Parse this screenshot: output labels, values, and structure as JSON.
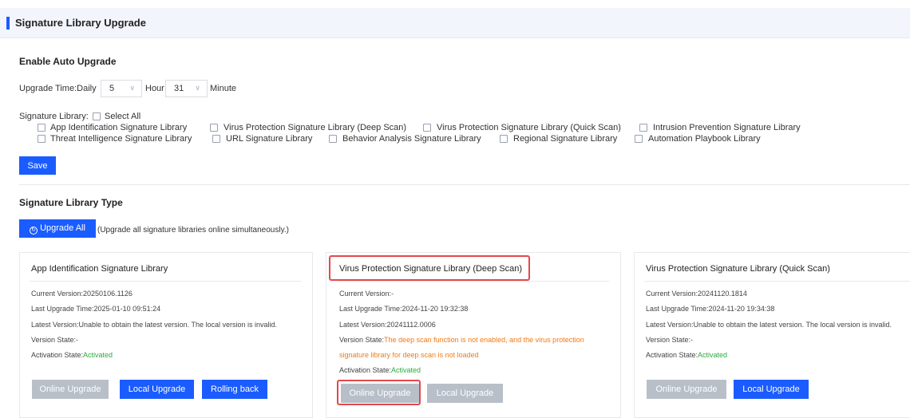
{
  "header": {
    "title": "Signature Library Upgrade"
  },
  "auto_upgrade": {
    "title": "Enable Auto Upgrade",
    "time_label": "Upgrade Time:Daily",
    "hour_value": "5",
    "hour_label": "Hour",
    "minute_value": "31",
    "minute_label": "Minute",
    "library_label": "Signature Library:",
    "select_all": "Select All",
    "libraries": [
      "App Identification Signature Library",
      "Virus Protection Signature Library (Deep Scan)",
      "Virus Protection Signature Library (Quick Scan)",
      "Intrusion Prevention Signature Library",
      "Threat Intelligence Signature Library",
      "URL Signature Library",
      "Behavior Analysis Signature Library",
      "Regional Signature Library",
      "Automation Playbook Library"
    ],
    "save_label": "Save"
  },
  "type_section": {
    "title": "Signature Library Type",
    "upgrade_all_label": "Upgrade All",
    "upgrade_all_icon": "refresh-circle-icon",
    "upgrade_all_hint": "(Upgrade all signature libraries online simultaneously.)"
  },
  "cards": [
    {
      "title": "App Identification Signature Library",
      "current_version": "Current Version:20250106.1126",
      "last_upgrade": "Last Upgrade Time:2025-01-10 09:51:24",
      "latest_version": "Latest Version:Unable to obtain the latest version. The local version is invalid.",
      "version_state_label": "Version State:",
      "version_state_value": "-",
      "activation_label": "Activation State:",
      "activation_value": "Activated",
      "online_upgrade": "Online Upgrade",
      "local_upgrade": "Local Upgrade",
      "rolling_back": "Rolling back"
    },
    {
      "title": "Virus Protection Signature Library (Deep Scan)",
      "current_version": "Current Version:-",
      "last_upgrade": "Last Upgrade Time:2024-11-20 19:32:38",
      "latest_version": "Latest Version:20241112.0006",
      "version_state_label": "Version State:",
      "version_state_value": "The deep scan function is not enabled, and the virus protection",
      "version_state_value_2": "signature library for deep scan is not loaded",
      "activation_label": "Activation State:",
      "activation_value": "Activated",
      "online_upgrade": "Online Upgrade",
      "local_upgrade": "Local Upgrade"
    },
    {
      "title": "Virus Protection Signature Library (Quick Scan)",
      "current_version": "Current Version:20241120.1814",
      "last_upgrade": "Last Upgrade Time:2024-11-20 19:34:38",
      "latest_version": "Latest Version:Unable to obtain the latest version. The local version is invalid.",
      "version_state_label": "Version State:",
      "version_state_value": "-",
      "activation_label": "Activation State:",
      "activation_value": "Activated",
      "online_upgrade": "Online Upgrade",
      "local_upgrade": "Local Upgrade"
    }
  ],
  "colors": {
    "accent": "#1a5cff",
    "disabled_button": "#b8bfc9",
    "success": "#2bab3e",
    "warning": "#f07a13",
    "highlight": "#e5484d"
  }
}
